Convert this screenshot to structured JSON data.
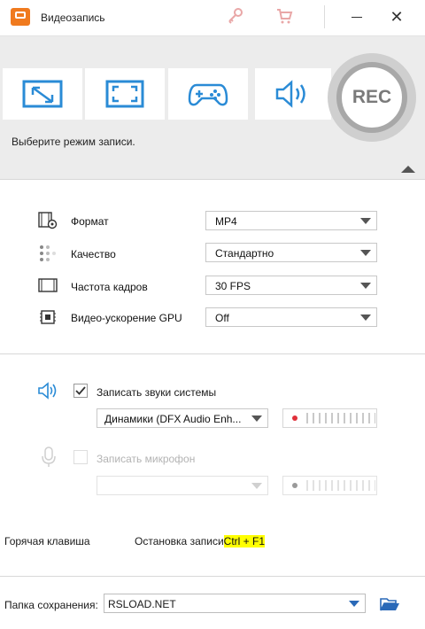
{
  "window": {
    "title": "Видеозапись",
    "icons": [
      "app-icon",
      "key-icon",
      "cart-icon",
      "minimize-icon",
      "close-icon"
    ]
  },
  "modes": {
    "items": [
      {
        "name": "region-record",
        "icon": "region-arrow-icon"
      },
      {
        "name": "fullscreen-record",
        "icon": "fullscreen-icon"
      },
      {
        "name": "game-record",
        "icon": "gamepad-icon"
      },
      {
        "name": "audio-record",
        "icon": "speaker-icon"
      }
    ],
    "rec_label": "REC",
    "hint": "Выберите режим записи."
  },
  "settings": {
    "format": {
      "label": "Формат",
      "value": "MP4",
      "icon": "film-gear-icon"
    },
    "quality": {
      "label": "Качество",
      "value": "Стандартно",
      "icon": "quality-dots-icon"
    },
    "framerate": {
      "label": "Частота кадров",
      "value": "30 FPS",
      "icon": "film-strip-icon"
    },
    "gpu": {
      "label": "Видео-ускорение GPU",
      "value": "Off",
      "icon": "chip-icon"
    }
  },
  "audio": {
    "system": {
      "label": "Записать звуки системы",
      "checked": true,
      "device": "Динамики (DFX Audio Enh...",
      "icon": "speaker-icon"
    },
    "mic": {
      "label": "Записать микрофон",
      "checked": false,
      "device": "",
      "icon": "microphone-icon"
    }
  },
  "hotkey": {
    "label": "Горячая клавиша",
    "action": "Остановка записи",
    "keys": "Ctrl + F1"
  },
  "save": {
    "label": "Папка сохранения:",
    "value": "RSLOAD.NET",
    "icon": "folder-open-icon"
  },
  "colors": {
    "accent": "#2a8bd6",
    "level_dot_active": "#e0303a",
    "hotkey_highlight": "#ffff00",
    "app_icon": "#f07a1e"
  }
}
